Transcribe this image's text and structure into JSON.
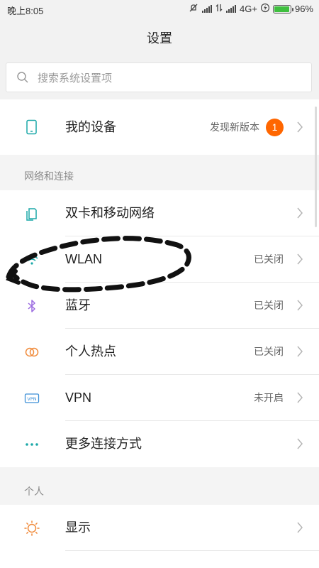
{
  "status_bar": {
    "time": "晚上8:05",
    "network": "4G+",
    "battery": "96%",
    "battery_level": 0.96
  },
  "header": {
    "title": "设置"
  },
  "search": {
    "placeholder": "搜索系统设置项"
  },
  "device": {
    "label": "我的设备",
    "status": "发现新版本",
    "badge": "1",
    "icon": "phone-icon"
  },
  "sections": [
    {
      "title": "网络和连接",
      "items": [
        {
          "label": "双卡和移动网络",
          "value": "",
          "icon": "sim-card-icon"
        },
        {
          "label": "WLAN",
          "value": "已关闭",
          "icon": "wifi-icon"
        },
        {
          "label": "蓝牙",
          "value": "已关闭",
          "icon": "bluetooth-icon"
        },
        {
          "label": "个人热点",
          "value": "已关闭",
          "icon": "hotspot-icon"
        },
        {
          "label": "VPN",
          "value": "未开启",
          "icon": "vpn-icon"
        },
        {
          "label": "更多连接方式",
          "value": "",
          "icon": "more-dots-icon"
        }
      ]
    },
    {
      "title": "个人",
      "items": [
        {
          "label": "显示",
          "value": "",
          "icon": "brightness-icon"
        }
      ]
    }
  ],
  "colors": {
    "accent_teal": "#1ba8a8",
    "bluetooth_purple": "#9b6be0",
    "hotspot_orange": "#f08a3a",
    "badge_orange": "#ff6600",
    "battery_green": "#3fbf3f"
  }
}
